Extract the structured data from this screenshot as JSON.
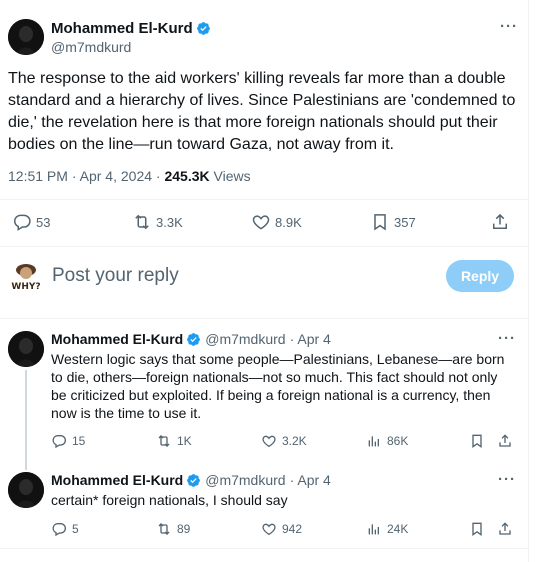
{
  "main_tweet": {
    "author_name": "Mohammed El-Kurd",
    "handle": "@m7mdkurd",
    "more_label": "···",
    "text": "The response to the aid workers' killing reveals far more than a double standard and a hierarchy of lives. Since Palestinians are 'condemned to die,' the revelation here is that more foreign nationals should put their bodies on the line—run toward Gaza, not away from it.",
    "time": "12:51 PM",
    "dot": "·",
    "date": "Apr 4, 2024",
    "views_count": "245.3K",
    "views_label": "Views",
    "stats": {
      "replies": "53",
      "reposts": "3.3K",
      "likes": "8.9K",
      "bookmarks": "357"
    }
  },
  "composer": {
    "avatar_caption": "WHY?",
    "placeholder": "Post your reply",
    "reply_button": "Reply"
  },
  "replies": [
    {
      "author_name": "Mohammed El-Kurd",
      "handle": "@m7mdkurd",
      "date": "· Apr 4",
      "more_label": "···",
      "text": "Western logic says that some people—Palestinians, Lebanese—are born to die, others—foreign nationals—not so much. This fact should not only be criticized but exploited. If being a foreign national is a currency, then now is the time to use it.",
      "replies": "15",
      "reposts": "1K",
      "likes": "3.2K",
      "views": "86K"
    },
    {
      "author_name": "Mohammed El-Kurd",
      "handle": "@m7mdkurd",
      "date": "· Apr 4",
      "more_label": "···",
      "text": "certain* foreign nationals, I should say",
      "replies": "5",
      "reposts": "89",
      "likes": "942",
      "views": "24K"
    }
  ],
  "colors": {
    "verified": "#1d9bf0",
    "secondary_text": "#536471",
    "primary_text": "#0f1419",
    "reply_button": "#8ecdf8",
    "divider": "#eff3f4"
  },
  "icons": [
    "verified-badge-icon",
    "more-icon",
    "reply-icon",
    "repost-icon",
    "like-icon",
    "bookmark-icon",
    "share-icon",
    "views-icon"
  ]
}
